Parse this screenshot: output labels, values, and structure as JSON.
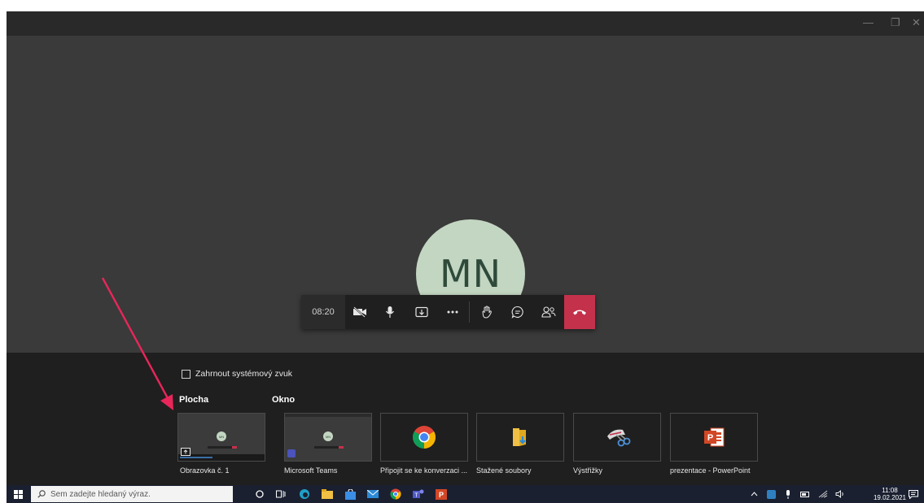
{
  "window": {
    "minimize": "—",
    "maximize": "❐",
    "close": "✕"
  },
  "caller": {
    "initials": "MN"
  },
  "call_controls": {
    "timer": "08:20"
  },
  "share_tray": {
    "system_audio_label": "Zahrnout systémový zvuk",
    "section_desktop": "Plocha",
    "section_window": "Okno",
    "items": [
      {
        "label": "Obrazovka č. 1",
        "kind": "screen"
      },
      {
        "label": "Microsoft Teams",
        "kind": "screen"
      },
      {
        "label": "Připojit se ke konverzaci ...",
        "kind": "chrome"
      },
      {
        "label": "Stažené soubory",
        "kind": "folder"
      },
      {
        "label": "Výstřižky",
        "kind": "snipping"
      },
      {
        "label": "prezentace - PowerPoint",
        "kind": "powerpoint"
      }
    ]
  },
  "taskbar": {
    "search_placeholder": "Sem zadejte hledaný výraz.",
    "time": "11:08",
    "date": "19.02.2021"
  },
  "colors": {
    "hangup": "#c4314b",
    "avatar": "#c3d6c2",
    "arrow": "#e8265a"
  }
}
